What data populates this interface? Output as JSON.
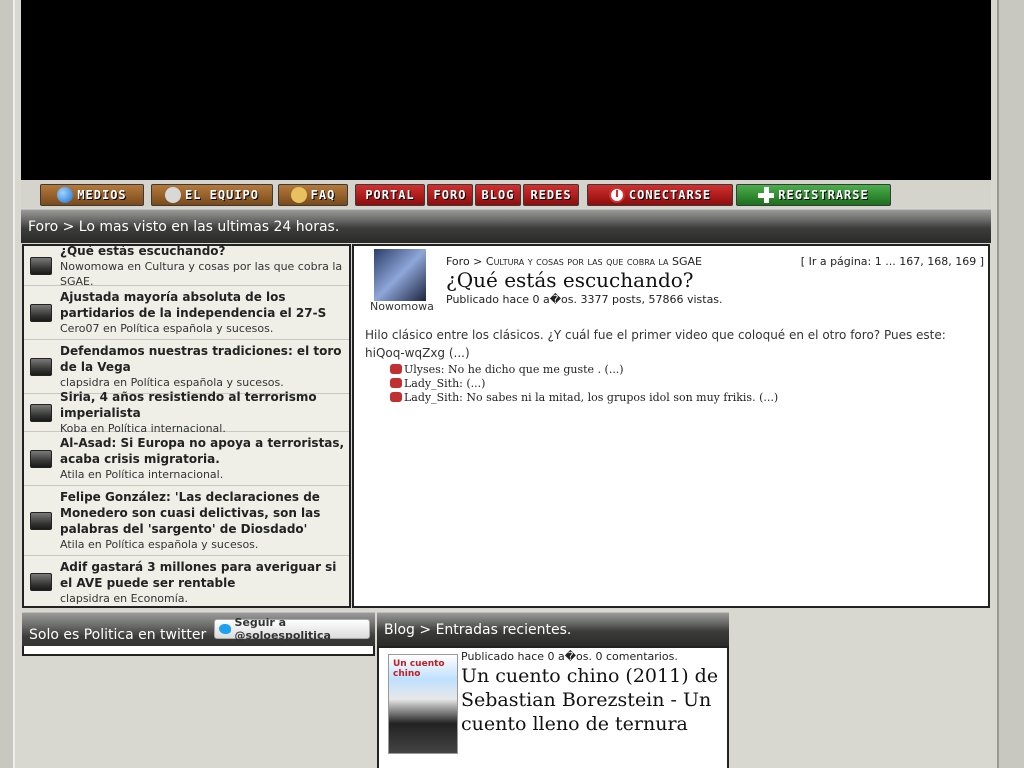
{
  "nav": {
    "medios": "MEDIOS",
    "equipo": "EL EQUIPO",
    "faq": "FAQ",
    "portal": "PORTAL",
    "foro": "FORO",
    "blog": "BLOG",
    "redes": "REDES",
    "conectarse": "CONECTARSE",
    "registrarse": "REGISTRARSE"
  },
  "foro_header": "Foro > Lo mas visto en las ultimas 24 horas.",
  "foro_items": [
    {
      "title": "¿Qué estás escuchando?",
      "meta": "Nowomowa en Cultura y cosas por las que cobra la SGAE."
    },
    {
      "title": "Ajustada mayoría absoluta de los partidarios de la independencia el 27-S",
      "meta": "Cero07 en Política española y sucesos."
    },
    {
      "title": "Defendamos nuestras tradiciones: el toro de la Vega",
      "meta": "clapsidra en Política española y sucesos."
    },
    {
      "title": "Siria, 4 años resistiendo al terrorismo imperialista",
      "meta": "Koba en Política internacional."
    },
    {
      "title": "Al-Asad: Si Europa no apoya a terroristas, acaba crisis migratoria.",
      "meta": "Atila en Política internacional."
    },
    {
      "title": "Felipe González: 'Las declaraciones de Monedero son cuasi delictivas, son las palabras del 'sargento' de Diosdado'",
      "meta": "Atila en Política española y sucesos."
    },
    {
      "title": "Adif gastará 3 millones para averiguar si el AVE puede ser rentable",
      "meta": "clapsidra en Economía."
    }
  ],
  "thread": {
    "avatar_name": "Nowomowa",
    "breadcrumb_root": "Foro >",
    "breadcrumb_cat": "Cultura y cosas por las que cobra la SGAE",
    "pages": "[ Ir a página: 1 ... 167, 168, 169 ]",
    "title": "¿Qué estás escuchando?",
    "meta": "Publicado hace 0 a�os.   3377 posts,  57866 vistas.",
    "body": "Hilo clásico entre los clásicos. ¿Y cuál fue el primer video que coloqué en el otro foro? Pues este: hiQoq-wqZxg (...)",
    "replies": [
      {
        "text": "Ulyses:  No he dicho que me guste . (...)"
      },
      {
        "text": "Lady_Sith:  (...)"
      },
      {
        "text": "Lady_Sith:  No sabes ni la mitad, los grupos idol son muy frikis. (...)"
      }
    ]
  },
  "twitter": {
    "header": "Solo es Politica en twitter",
    "follow": "Seguir a @soloespolitica"
  },
  "blog": {
    "header": "Blog > Entradas recientes.",
    "meta": "Publicado hace 0 a�os.   0 comentarios.",
    "title": "Un cuento chino (2011) de Sebastian Borezstein - Un cuento lleno de ternura",
    "thumb_label": "Un cuento chino"
  }
}
